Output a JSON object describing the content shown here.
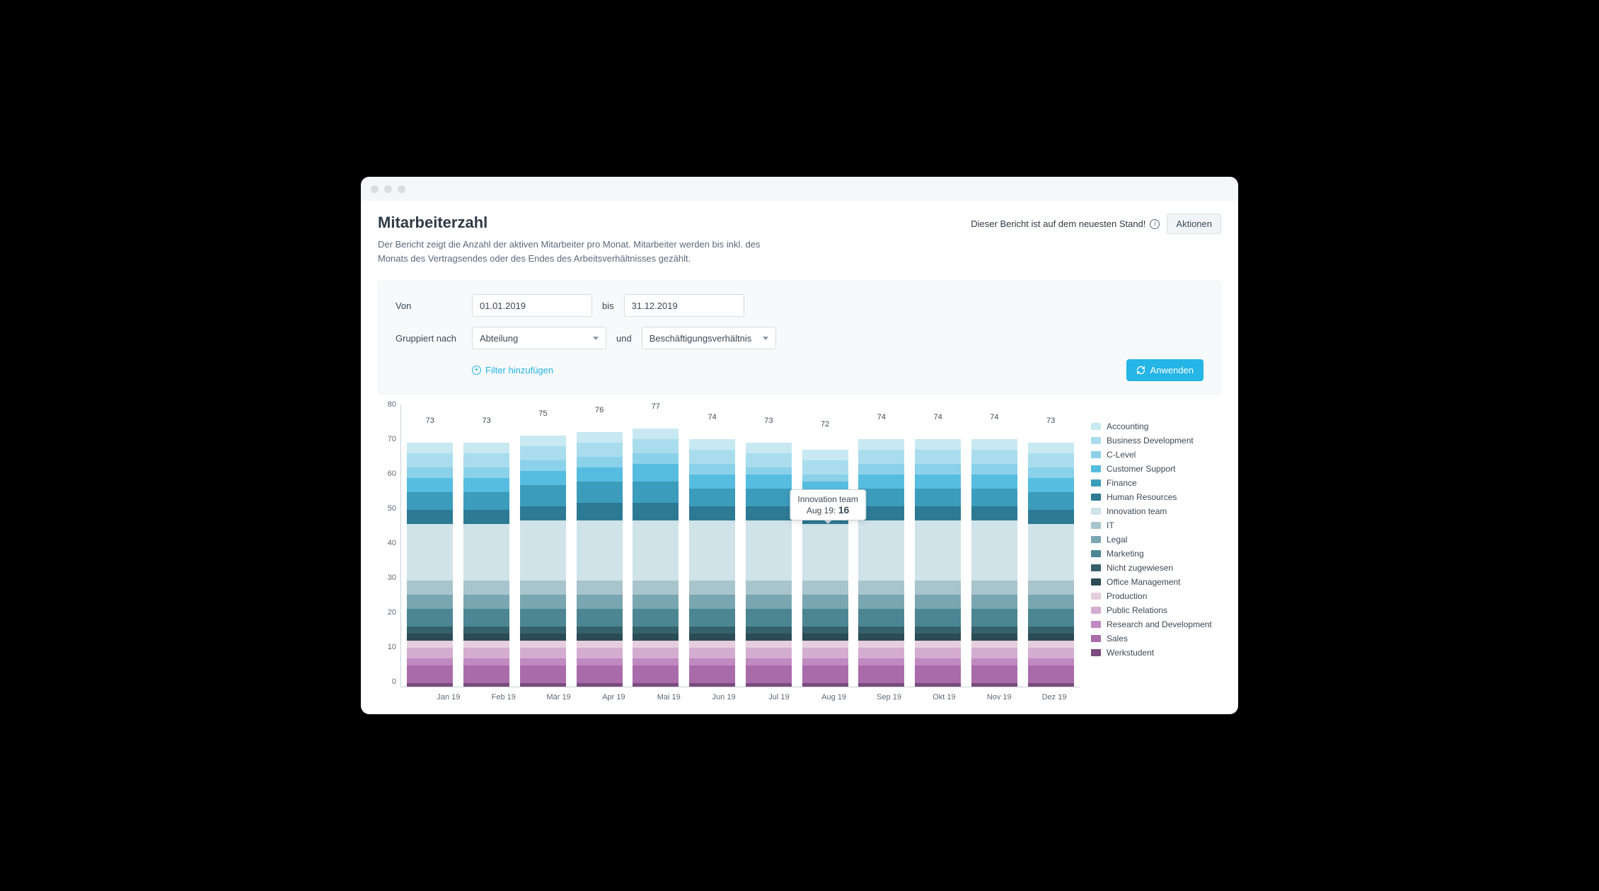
{
  "header": {
    "title": "Mitarbeiterzahl",
    "subtitle": "Der Bericht zeigt die Anzahl der aktiven Mitarbeiter pro Monat. Mitarbeiter werden bis inkl. des Monats des Vertragsendes oder des Endes des Arbeitsverhältnisses gezählt.",
    "status": "Dieser Bericht ist auf dem neuesten Stand!",
    "actions_label": "Aktionen"
  },
  "filters": {
    "from_label": "Von",
    "from_value": "01.01.2019",
    "to_label": "bis",
    "to_value": "31.12.2019",
    "groupby_label": "Gruppiert nach",
    "group1_value": "Abteilung",
    "and_label": "und",
    "group2_value": "Beschäftigungsverhältnis",
    "add_filter_label": "Filter hinzufügen",
    "apply_label": "Anwenden"
  },
  "tooltip": {
    "series": "Innovation team",
    "period": "Aug 19",
    "sep": ":",
    "value": "16",
    "month_index": 7
  },
  "chart_data": {
    "type": "bar",
    "stacked": true,
    "title": "Mitarbeiterzahl",
    "xlabel": "",
    "ylabel": "",
    "ylim": [
      0,
      80
    ],
    "yticks": [
      0,
      10,
      20,
      30,
      40,
      50,
      60,
      70,
      80
    ],
    "categories": [
      "Jan 19",
      "Feb 19",
      "Mär 19",
      "Apr 19",
      "Mai 19",
      "Jun 19",
      "Jul 19",
      "Aug 19",
      "Sep 19",
      "Okt 19",
      "Nov 19",
      "Dez 19"
    ],
    "totals": [
      73,
      73,
      75,
      76,
      77,
      74,
      73,
      72,
      74,
      74,
      74,
      73
    ],
    "series": [
      {
        "name": "Accounting",
        "color": "#c8e9f2",
        "values": [
          3,
          3,
          3,
          3,
          3,
          3,
          3,
          3,
          3,
          3,
          3,
          3
        ]
      },
      {
        "name": "Business Development",
        "color": "#a9ddee",
        "values": [
          4,
          4,
          4,
          4,
          4,
          4,
          4,
          4,
          4,
          4,
          4,
          4
        ]
      },
      {
        "name": "C-Level",
        "color": "#8bd1ea",
        "values": [
          3,
          3,
          3,
          3,
          3,
          3,
          2,
          2,
          3,
          3,
          3,
          3
        ]
      },
      {
        "name": "Customer Support",
        "color": "#56bde0",
        "values": [
          4,
          4,
          4,
          4,
          5,
          4,
          4,
          4,
          4,
          4,
          4,
          4
        ]
      },
      {
        "name": "Finance",
        "color": "#3c9cbc",
        "values": [
          5,
          5,
          6,
          6,
          6,
          5,
          5,
          4,
          5,
          5,
          5,
          5
        ]
      },
      {
        "name": "Human Resources",
        "color": "#2d7a94",
        "values": [
          4,
          4,
          4,
          5,
          5,
          4,
          4,
          4,
          4,
          4,
          4,
          4
        ]
      },
      {
        "name": "Innovation team",
        "color": "#cfe3e9",
        "values": [
          16,
          16,
          17,
          17,
          17,
          17,
          17,
          16,
          17,
          17,
          17,
          16
        ]
      },
      {
        "name": "IT",
        "color": "#a8c4cc",
        "values": [
          4,
          4,
          4,
          4,
          4,
          4,
          4,
          4,
          4,
          4,
          4,
          4
        ]
      },
      {
        "name": "Legal",
        "color": "#7aa6b1",
        "values": [
          4,
          4,
          4,
          4,
          4,
          4,
          4,
          4,
          4,
          4,
          4,
          4
        ]
      },
      {
        "name": "Marketing",
        "color": "#4c8693",
        "values": [
          5,
          5,
          5,
          5,
          5,
          5,
          5,
          5,
          5,
          5,
          5,
          5
        ]
      },
      {
        "name": "Nicht zugewiesen",
        "color": "#35616c",
        "values": [
          2,
          2,
          2,
          2,
          2,
          2,
          2,
          2,
          2,
          2,
          2,
          2
        ]
      },
      {
        "name": "Office Management",
        "color": "#2b4b55",
        "values": [
          2,
          2,
          2,
          2,
          2,
          2,
          2,
          2,
          2,
          2,
          2,
          2
        ]
      },
      {
        "name": "Production",
        "color": "#e6cede",
        "values": [
          2,
          2,
          2,
          2,
          2,
          2,
          2,
          2,
          2,
          2,
          2,
          2
        ]
      },
      {
        "name": "Public Relations",
        "color": "#d3add0",
        "values": [
          3,
          3,
          3,
          3,
          3,
          3,
          3,
          3,
          3,
          3,
          3,
          3
        ]
      },
      {
        "name": "Research and Development",
        "color": "#c08ac1",
        "values": [
          2,
          2,
          2,
          2,
          2,
          2,
          2,
          2,
          2,
          2,
          2,
          2
        ]
      },
      {
        "name": "Sales",
        "color": "#aa6bab",
        "values": [
          5,
          5,
          5,
          5,
          5,
          5,
          5,
          5,
          5,
          5,
          5,
          5
        ]
      },
      {
        "name": "Werkstudent",
        "color": "#7a4b7e",
        "values": [
          1,
          1,
          1,
          1,
          1,
          1,
          1,
          1,
          1,
          1,
          1,
          1
        ]
      }
    ]
  }
}
